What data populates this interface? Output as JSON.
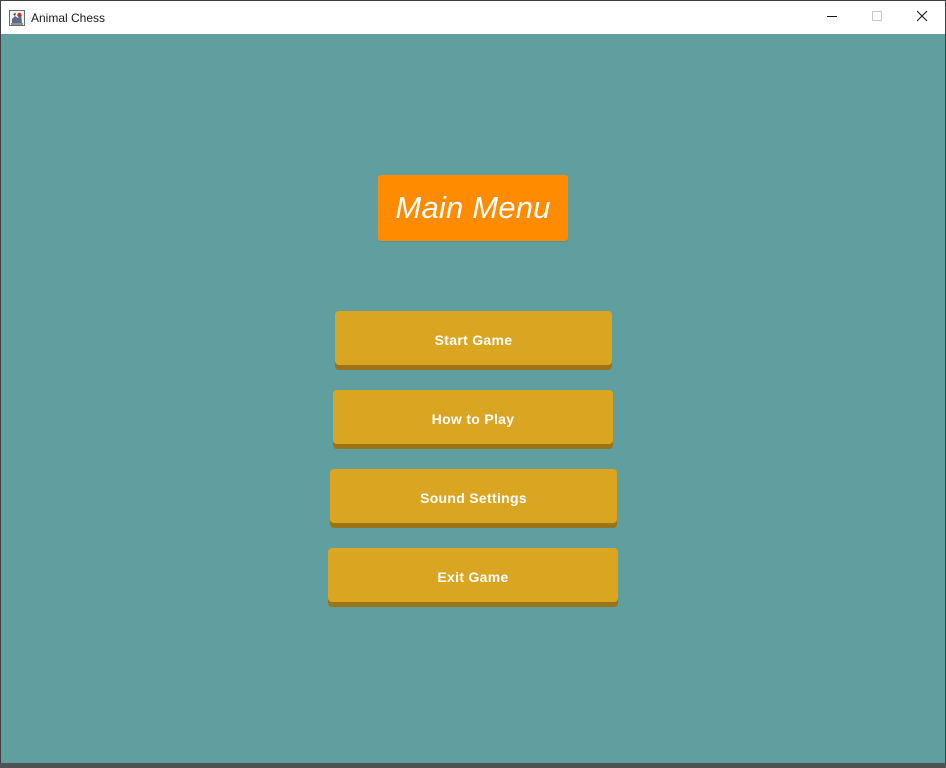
{
  "window": {
    "title": "Animal Chess",
    "controls": {
      "minimize": "minimize-icon",
      "maximize": "maximize-icon",
      "close": "close-icon"
    }
  },
  "menu": {
    "title": "Main Menu",
    "buttons": [
      {
        "label": "Start Game"
      },
      {
        "label": "How to Play"
      },
      {
        "label": "Sound Settings"
      },
      {
        "label": "Exit Game"
      }
    ]
  },
  "colors": {
    "background": "#609fa0",
    "title_panel": "#ff8c00",
    "button": "#daa520",
    "button_shadow": "#9c7416",
    "text": "#ffffff"
  }
}
